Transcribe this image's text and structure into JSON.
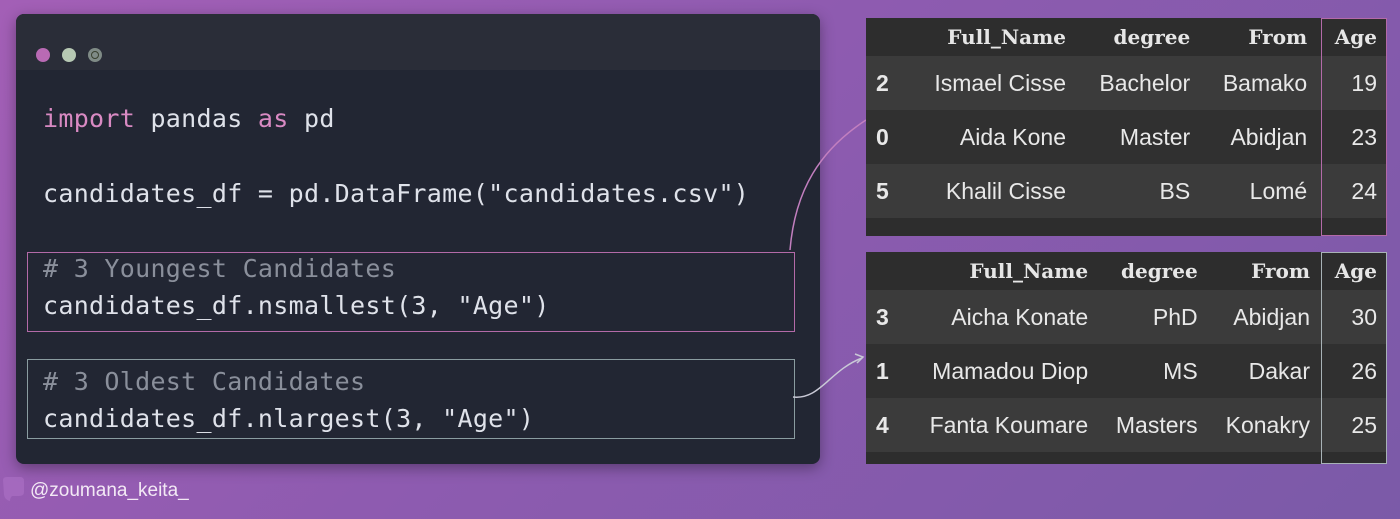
{
  "editor": {
    "lines": {
      "import_kw": "import",
      "import_mod": " pandas ",
      "as_kw": "as",
      "alias": " pd",
      "assign": "candidates_df = pd.DataFrame(\"candidates.csv\")",
      "comment_young": "# 3 Youngest Candidates",
      "call_small": "candidates_df.nsmallest(3, \"Age\")",
      "comment_old": "# 3 Oldest Candidates",
      "call_large": "candidates_df.nlargest(3, \"Age\")"
    }
  },
  "tables": {
    "youngest": {
      "headers": [
        "",
        "Full_Name",
        "degree",
        "From",
        "Age"
      ],
      "rows": [
        [
          "2",
          "Ismael Cisse",
          "Bachelor",
          "Bamako",
          "19"
        ],
        [
          "0",
          "Aida Kone",
          "Master",
          "Abidjan",
          "23"
        ],
        [
          "5",
          "Khalil Cisse",
          "BS",
          "Lomé",
          "24"
        ]
      ]
    },
    "oldest": {
      "headers": [
        "",
        "Full_Name",
        "degree",
        "From",
        "Age"
      ],
      "rows": [
        [
          "3",
          "Aicha Konate",
          "PhD",
          "Abidjan",
          "30"
        ],
        [
          "1",
          "Mamadou Diop",
          "MS",
          "Dakar",
          "26"
        ],
        [
          "4",
          "Fanta Koumare",
          "Masters",
          "Konakry",
          "25"
        ]
      ]
    }
  },
  "footer": {
    "handle": "@zoumana_keita_"
  },
  "colors": {
    "background": "#8e5bb0",
    "editor_bg": "#222633",
    "keyword": "#d98ac3",
    "highlight_pink": "#b36aa8",
    "highlight_grey": "#8a9ca0",
    "table_bg": "#2d2d2d"
  }
}
